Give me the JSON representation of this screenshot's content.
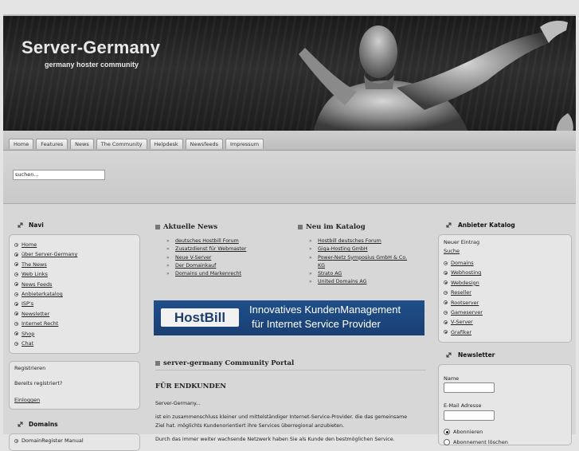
{
  "header": {
    "title": "Server-Germany",
    "subtitle": "germany hoster community"
  },
  "nav": {
    "tabs": [
      "Home",
      "Features",
      "News",
      "The Community",
      "Helpdesk",
      "Newsfeeds",
      "Impressum"
    ]
  },
  "search": {
    "value": "suchen..."
  },
  "left": {
    "navi_title": "Navi",
    "navi_items": [
      "Home",
      "über Server-Germany",
      "The News",
      "Web Links",
      "News Feeds",
      "Anbieterkatalog",
      "ISP's",
      "Newsletter",
      "Internet Recht",
      "Shop",
      "Chat"
    ],
    "login": {
      "register": "Registrieren",
      "already": "Bereits registriert?",
      "login": "Einloggen"
    },
    "domains_title": "Domains",
    "domains_items": [
      "DomainRegister Manual"
    ]
  },
  "center": {
    "news_title": "Aktuelle News",
    "news_items": [
      "deutsches Hostbill Forum",
      "Zusatzdienst für Webmaster",
      "Neue V-Server",
      "Der Domainkauf",
      "Domains und Markenrecht"
    ],
    "catalog_title": "Neu im Katalog",
    "catalog_items": [
      "Hostbill deutsches Forum",
      "Giga-Hosting GmbH",
      "Power-Netz Symposius GmbH & Co.",
      "KG",
      "Strato AG",
      "United Domains AG"
    ],
    "banner": {
      "logo": "HostBill",
      "line1": "Innovatives KundenManagement",
      "line2": "für Internet Service Provider"
    },
    "portal_title": "server-germany Community Portal",
    "section_title": "FÜR ENDKUNDEN",
    "paragraphs": [
      "Server-Germany...",
      "ist ein zusammenschluss kleiner und mittelständiger Internet-Service-Provider. die das gemeinsame",
      "Ziel hat. möglichts Kundenorientiert ihre Services überregional anzubieten.",
      "Durch das immer weiter wachsende Netzwerk haben Sie als Kunde den bestmöglichen Service."
    ]
  },
  "right": {
    "catalog_title": "Anbieter Katalog",
    "new_entry": "Neuer Eintrag",
    "search": "Suche",
    "catalog_items": [
      "Domains",
      "Webhosting",
      "Webdesign",
      "Reseller",
      "Rootserver",
      "Gameserver",
      "V-Server",
      "Grafiker"
    ],
    "newsletter_title": "Newsletter",
    "name_label": "Name",
    "email_label": "E-Mail Adresse",
    "subscribe": "Abonnieren",
    "unsubscribe": "Abonnement löschen"
  }
}
